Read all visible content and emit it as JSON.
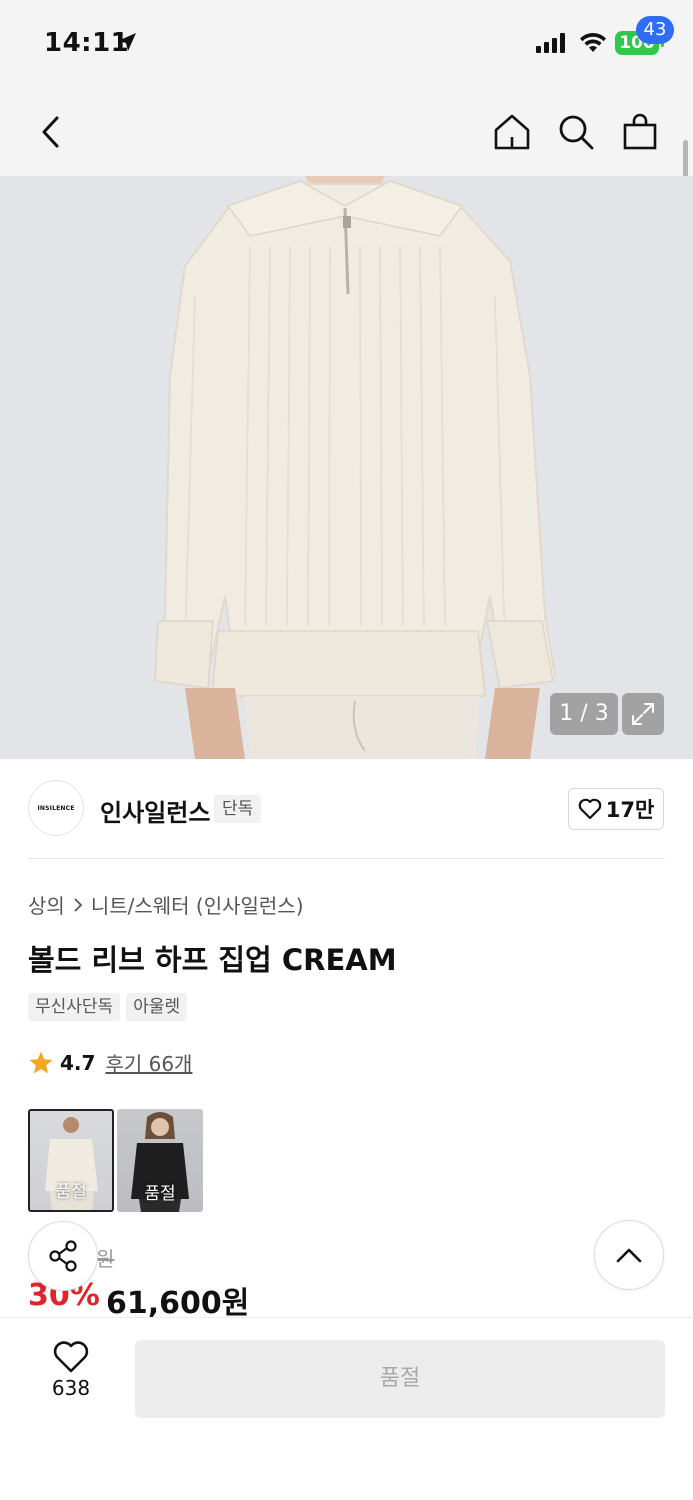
{
  "status_bar": {
    "time": "14:11",
    "battery": "100"
  },
  "nav": {
    "cart_count": "43"
  },
  "gallery": {
    "counter": "1 / 3"
  },
  "brand": {
    "logo_text": "INSILENCE",
    "name": "인사일런스",
    "tag": "단독",
    "likes": "17만"
  },
  "product": {
    "breadcrumb": [
      "상의",
      "니트/스웨터 (인사일런스)"
    ],
    "title": "볼드 리브 하프 집업 CREAM",
    "tags": [
      "무신사단독",
      "아울렛"
    ],
    "rating": "4.7",
    "review_link": "후기 66개",
    "options": [
      {
        "label": "품절",
        "color": "cream"
      },
      {
        "label": "품절",
        "color": "black"
      }
    ],
    "original_price": "원",
    "discount": "30%",
    "sale_price": "61,600원"
  },
  "bottom": {
    "wish_count": "638",
    "buy_label": "품절"
  },
  "colors": {
    "accent_blue": "#2f6df6",
    "discount_red": "#e0242b",
    "star": "#f5a623",
    "battery_green": "#30c84b"
  }
}
